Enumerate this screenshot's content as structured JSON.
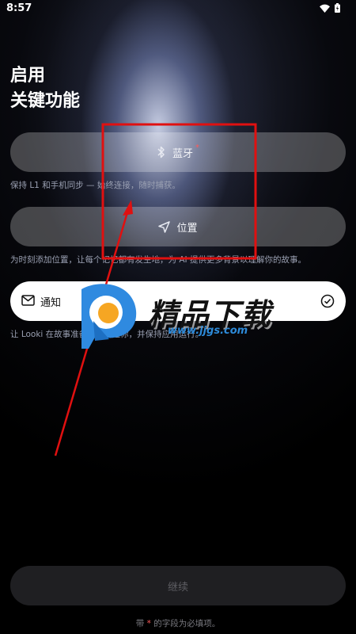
{
  "status_bar": {
    "time": "8:57",
    "icons": [
      "wifi-icon",
      "battery-icon"
    ]
  },
  "header": {
    "title_line1": "启用",
    "title_line2": "关键功能"
  },
  "permissions": {
    "bluetooth": {
      "label": "蓝牙",
      "required_mark": "*",
      "icon": "bluetooth-icon",
      "description": "保持 L1 和手机同步 — 始终连接，随时捕获。"
    },
    "location": {
      "label": "位置",
      "icon": "navigation-arrow-icon",
      "description": "为时刻添加位置，让每个记忆都有发生地，为 AI 提供更多背景以理解你的故事。"
    },
    "notification": {
      "label": "通知",
      "icon": "mail-icon",
      "status_icon": "check-circle-icon",
      "description": "让 Looki 在故事准备好时提醒你，并保持应用运行。"
    }
  },
  "continue_button": {
    "label": "继续"
  },
  "footnote": {
    "prefix": "带",
    "star": "*",
    "suffix": "的字段为必填项。"
  },
  "watermark": {
    "text": "精品下载",
    "url": "www.jjgs.com"
  },
  "colors": {
    "background": "#000000",
    "button_bg": "#ffffff40",
    "notify_bg": "#ffffff",
    "required": "#ff5b5b",
    "annotation": "#e01010"
  }
}
